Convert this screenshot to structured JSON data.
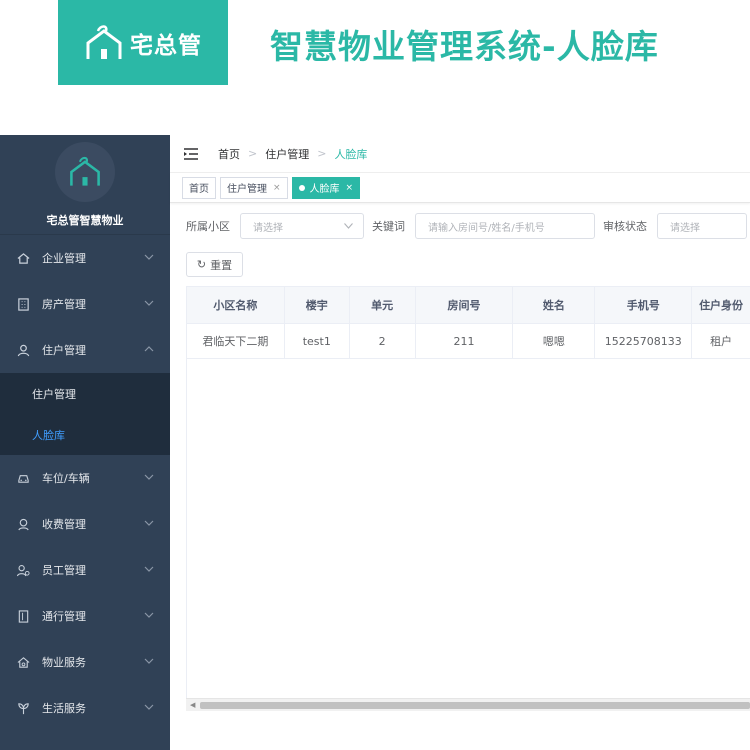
{
  "banner": {
    "logo_text": "宅总管",
    "title": "智慧物业管理系统-人脸库"
  },
  "sidebar": {
    "brand": "宅总管智慧物业",
    "items": [
      {
        "label": "企业管理",
        "icon": "home-icon"
      },
      {
        "label": "房产管理",
        "icon": "building-icon"
      },
      {
        "label": "住户管理",
        "icon": "user-icon",
        "expanded": true,
        "children": [
          {
            "label": "住户管理",
            "active": false
          },
          {
            "label": "人脸库",
            "active": true
          }
        ]
      },
      {
        "label": "车位/车辆",
        "icon": "car-icon"
      },
      {
        "label": "收费管理",
        "icon": "money-icon"
      },
      {
        "label": "员工管理",
        "icon": "staff-icon"
      },
      {
        "label": "通行管理",
        "icon": "door-icon"
      },
      {
        "label": "物业服务",
        "icon": "service-icon"
      },
      {
        "label": "生活服务",
        "icon": "leaf-icon"
      }
    ]
  },
  "navbar": {
    "breadcrumb": [
      "首页",
      "住户管理",
      "人脸库"
    ]
  },
  "tags": [
    {
      "label": "首页",
      "closable": false,
      "active": false
    },
    {
      "label": "住户管理",
      "closable": true,
      "active": false
    },
    {
      "label": "人脸库",
      "closable": true,
      "active": true
    }
  ],
  "filters": {
    "community_label": "所属小区",
    "community_placeholder": "请选择",
    "keyword_label": "关键词",
    "keyword_placeholder": "请输入房间号/姓名/手机号",
    "status_label": "审核状态",
    "status_placeholder": "请选择"
  },
  "reset_label": "重置",
  "table": {
    "columns": [
      "小区名称",
      "楼宇",
      "单元",
      "房间号",
      "姓名",
      "手机号",
      "住户身份"
    ],
    "rows": [
      [
        "君临天下二期",
        "test1",
        "2",
        "211",
        "嗯嗯",
        "15225708133",
        "租户"
      ]
    ]
  },
  "colors": {
    "accent": "#2bb8a6",
    "sidebar_bg": "#304156",
    "submenu_bg": "#1f2d3d",
    "active_link": "#409eff"
  }
}
